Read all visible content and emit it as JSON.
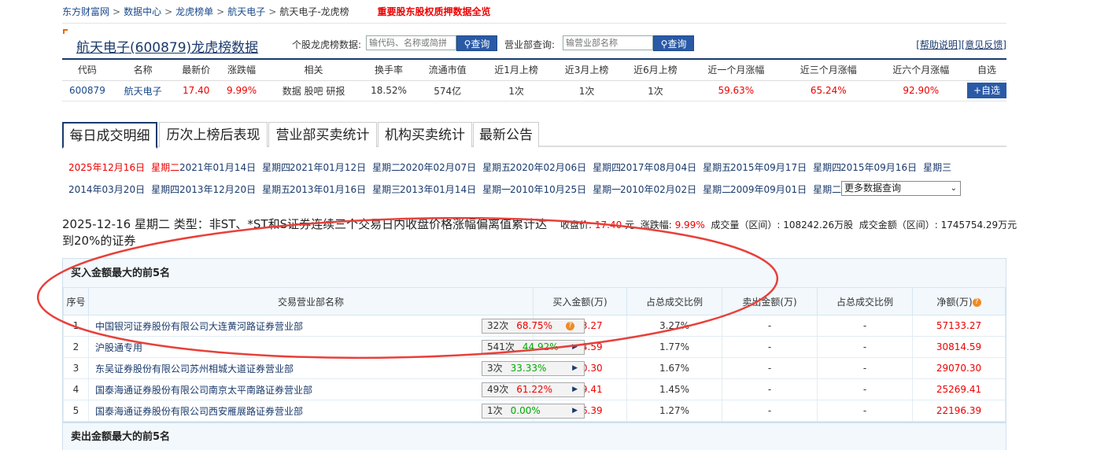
{
  "breadcrumb": {
    "items": [
      "东方财富网",
      "数据中心",
      "龙虎榜单",
      "航天电子",
      "航天电子-龙虎榜"
    ],
    "separator": ">",
    "hot_link": "重要股东股权质押数据全览"
  },
  "header": {
    "title": "航天电子(600879)龙虎榜数据",
    "stock_query_label": "个股龙虎榜数据:",
    "stock_query_placeholder": "输代码、名称或简拼",
    "query_button": "查询",
    "dept_query_label": "营业部查询:",
    "dept_query_placeholder": "输营业部名称",
    "help_link": "[帮助说明]",
    "feedback_link": "[意见反馈]"
  },
  "summary": {
    "headers": [
      "代码",
      "名称",
      "最新价",
      "涨跌幅",
      "相关",
      "换手率",
      "流通市值",
      "近1月上榜",
      "近3月上榜",
      "近6月上榜",
      "近一个月涨幅",
      "近三个月涨幅",
      "近六个月涨幅",
      "自选"
    ],
    "row": {
      "code": "600879",
      "name": "航天电子",
      "price": "17.40",
      "change": "9.99%",
      "related": [
        "数据",
        "股吧",
        "研报"
      ],
      "turnover": "18.52%",
      "market_cap": "574亿",
      "m1": "1次",
      "m3": "1次",
      "m6": "1次",
      "r1": "59.63%",
      "r3": "65.24%",
      "r6": "92.90%",
      "add_button": "+自选"
    }
  },
  "tabs": [
    "每日成交明细",
    "历次上榜后表现",
    "营业部买卖统计",
    "机构买卖统计",
    "最新公告"
  ],
  "dates": {
    "row1": [
      {
        "date": "2025年12月16日",
        "weekday": "星期二"
      },
      {
        "date": "2021年01月14日",
        "weekday": "星期四"
      },
      {
        "date": "2021年01月12日",
        "weekday": "星期二"
      },
      {
        "date": "2020年02月07日",
        "weekday": "星期五"
      },
      {
        "date": "2020年02月06日",
        "weekday": "星期四"
      },
      {
        "date": "2017年08月04日",
        "weekday": "星期五"
      },
      {
        "date": "2015年09月17日",
        "weekday": "星期四"
      },
      {
        "date": "2015年09月16日",
        "weekday": "星期三"
      }
    ],
    "row2": [
      {
        "date": "2014年03月20日",
        "weekday": "星期四"
      },
      {
        "date": "2013年12月20日",
        "weekday": "星期五"
      },
      {
        "date": "2013年01月16日",
        "weekday": "星期三"
      },
      {
        "date": "2013年01月14日",
        "weekday": "星期一"
      },
      {
        "date": "2010年10月25日",
        "weekday": "星期一"
      },
      {
        "date": "2010年02月02日",
        "weekday": "星期二"
      },
      {
        "date": "2009年09月01日",
        "weekday": "星期二"
      }
    ],
    "more_select": "更多数据查询"
  },
  "info": {
    "title": "2025-12-16 星期二 类型：非ST、*ST和S证券连续三个交易日内收盘价格涨幅偏离值累计达到20%的证券",
    "close_label": "收盘价:",
    "close_value": "17.40",
    "close_unit": "元",
    "change_label": "涨跌幅:",
    "change_value": "9.99%",
    "volume_label": "成交量（区间）:",
    "volume_value": "108242.26万股",
    "amount_label": "成交金额（区间）:",
    "amount_value": "1745754.29万元"
  },
  "buy_table": {
    "title": "买入金额最大的前5名",
    "headers": [
      "序号",
      "交易营业部名称",
      "买入金额(万)",
      "占总成交比例",
      "卖出金额(万)",
      "占总成交比例",
      "净额(万)"
    ],
    "rows": [
      {
        "no": "1",
        "name": "中国银河证券股份有限公司大连黄河路证券营业部",
        "times": "32次",
        "rate": "68.75%",
        "rate_color": "red",
        "icon": "question",
        "buy": "57133.27",
        "buy_pct": "3.27%",
        "sell": "-",
        "sell_pct": "-",
        "net": "57133.27"
      },
      {
        "no": "2",
        "name": "沪股通专用",
        "times": "541次",
        "rate": "44.92%",
        "rate_color": "green",
        "icon": "arrow",
        "buy": "30814.59",
        "buy_pct": "1.77%",
        "sell": "-",
        "sell_pct": "-",
        "net": "30814.59"
      },
      {
        "no": "3",
        "name": "东吴证券股份有限公司苏州相城大道证券营业部",
        "times": "3次",
        "rate": "33.33%",
        "rate_color": "green",
        "icon": "arrow",
        "buy": "29070.30",
        "buy_pct": "1.67%",
        "sell": "-",
        "sell_pct": "-",
        "net": "29070.30"
      },
      {
        "no": "4",
        "name": "国泰海通证券股份有限公司南京太平南路证券营业部",
        "times": "49次",
        "rate": "61.22%",
        "rate_color": "red",
        "icon": "arrow",
        "buy": "25269.41",
        "buy_pct": "1.45%",
        "sell": "-",
        "sell_pct": "-",
        "net": "25269.41"
      },
      {
        "no": "5",
        "name": "国泰海通证券股份有限公司西安雁展路证券营业部",
        "times": "1次",
        "rate": "0.00%",
        "rate_color": "green",
        "icon": "arrow",
        "buy": "22196.39",
        "buy_pct": "1.27%",
        "sell": "-",
        "sell_pct": "-",
        "net": "22196.39"
      }
    ]
  },
  "sell_table": {
    "title": "卖出金额最大的前5名"
  },
  "colors": {
    "accent": "#2a5aa6",
    "up": "#ee0000",
    "down": "#00aa00",
    "link": "#1a3a6c",
    "annotation": "#e8403a"
  }
}
